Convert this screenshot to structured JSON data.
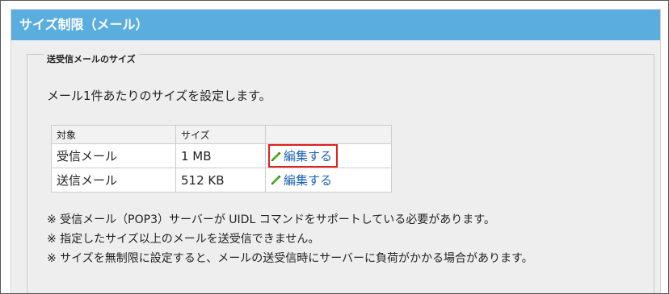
{
  "header": {
    "title": "サイズ制限（メール）"
  },
  "section": {
    "legend": "送受信メールのサイズ",
    "description": "メール1件あたりのサイズを設定します。"
  },
  "table": {
    "headers": [
      "対象",
      "サイズ",
      ""
    ],
    "rows": [
      {
        "target": "受信メール",
        "size": "1 MB",
        "action": "編集する",
        "highlighted": true
      },
      {
        "target": "送信メール",
        "size": "512 KB",
        "action": "編集する",
        "highlighted": false
      }
    ]
  },
  "notes": [
    "※ 受信メール（POP3）サーバーが UIDL コマンドをサポートしている必要があります。",
    "※ 指定したサイズ以上のメールを送受信できません。",
    "※ サイズを無制限に設定すると、メールの送受信時にサーバーに負荷がかかる場合があります。"
  ],
  "colors": {
    "header_bg": "#5aaedf",
    "link": "#1a62b8",
    "highlight": "#e02020",
    "pencil": "#4caf20"
  },
  "icons": {
    "edit": "pencil-icon"
  }
}
